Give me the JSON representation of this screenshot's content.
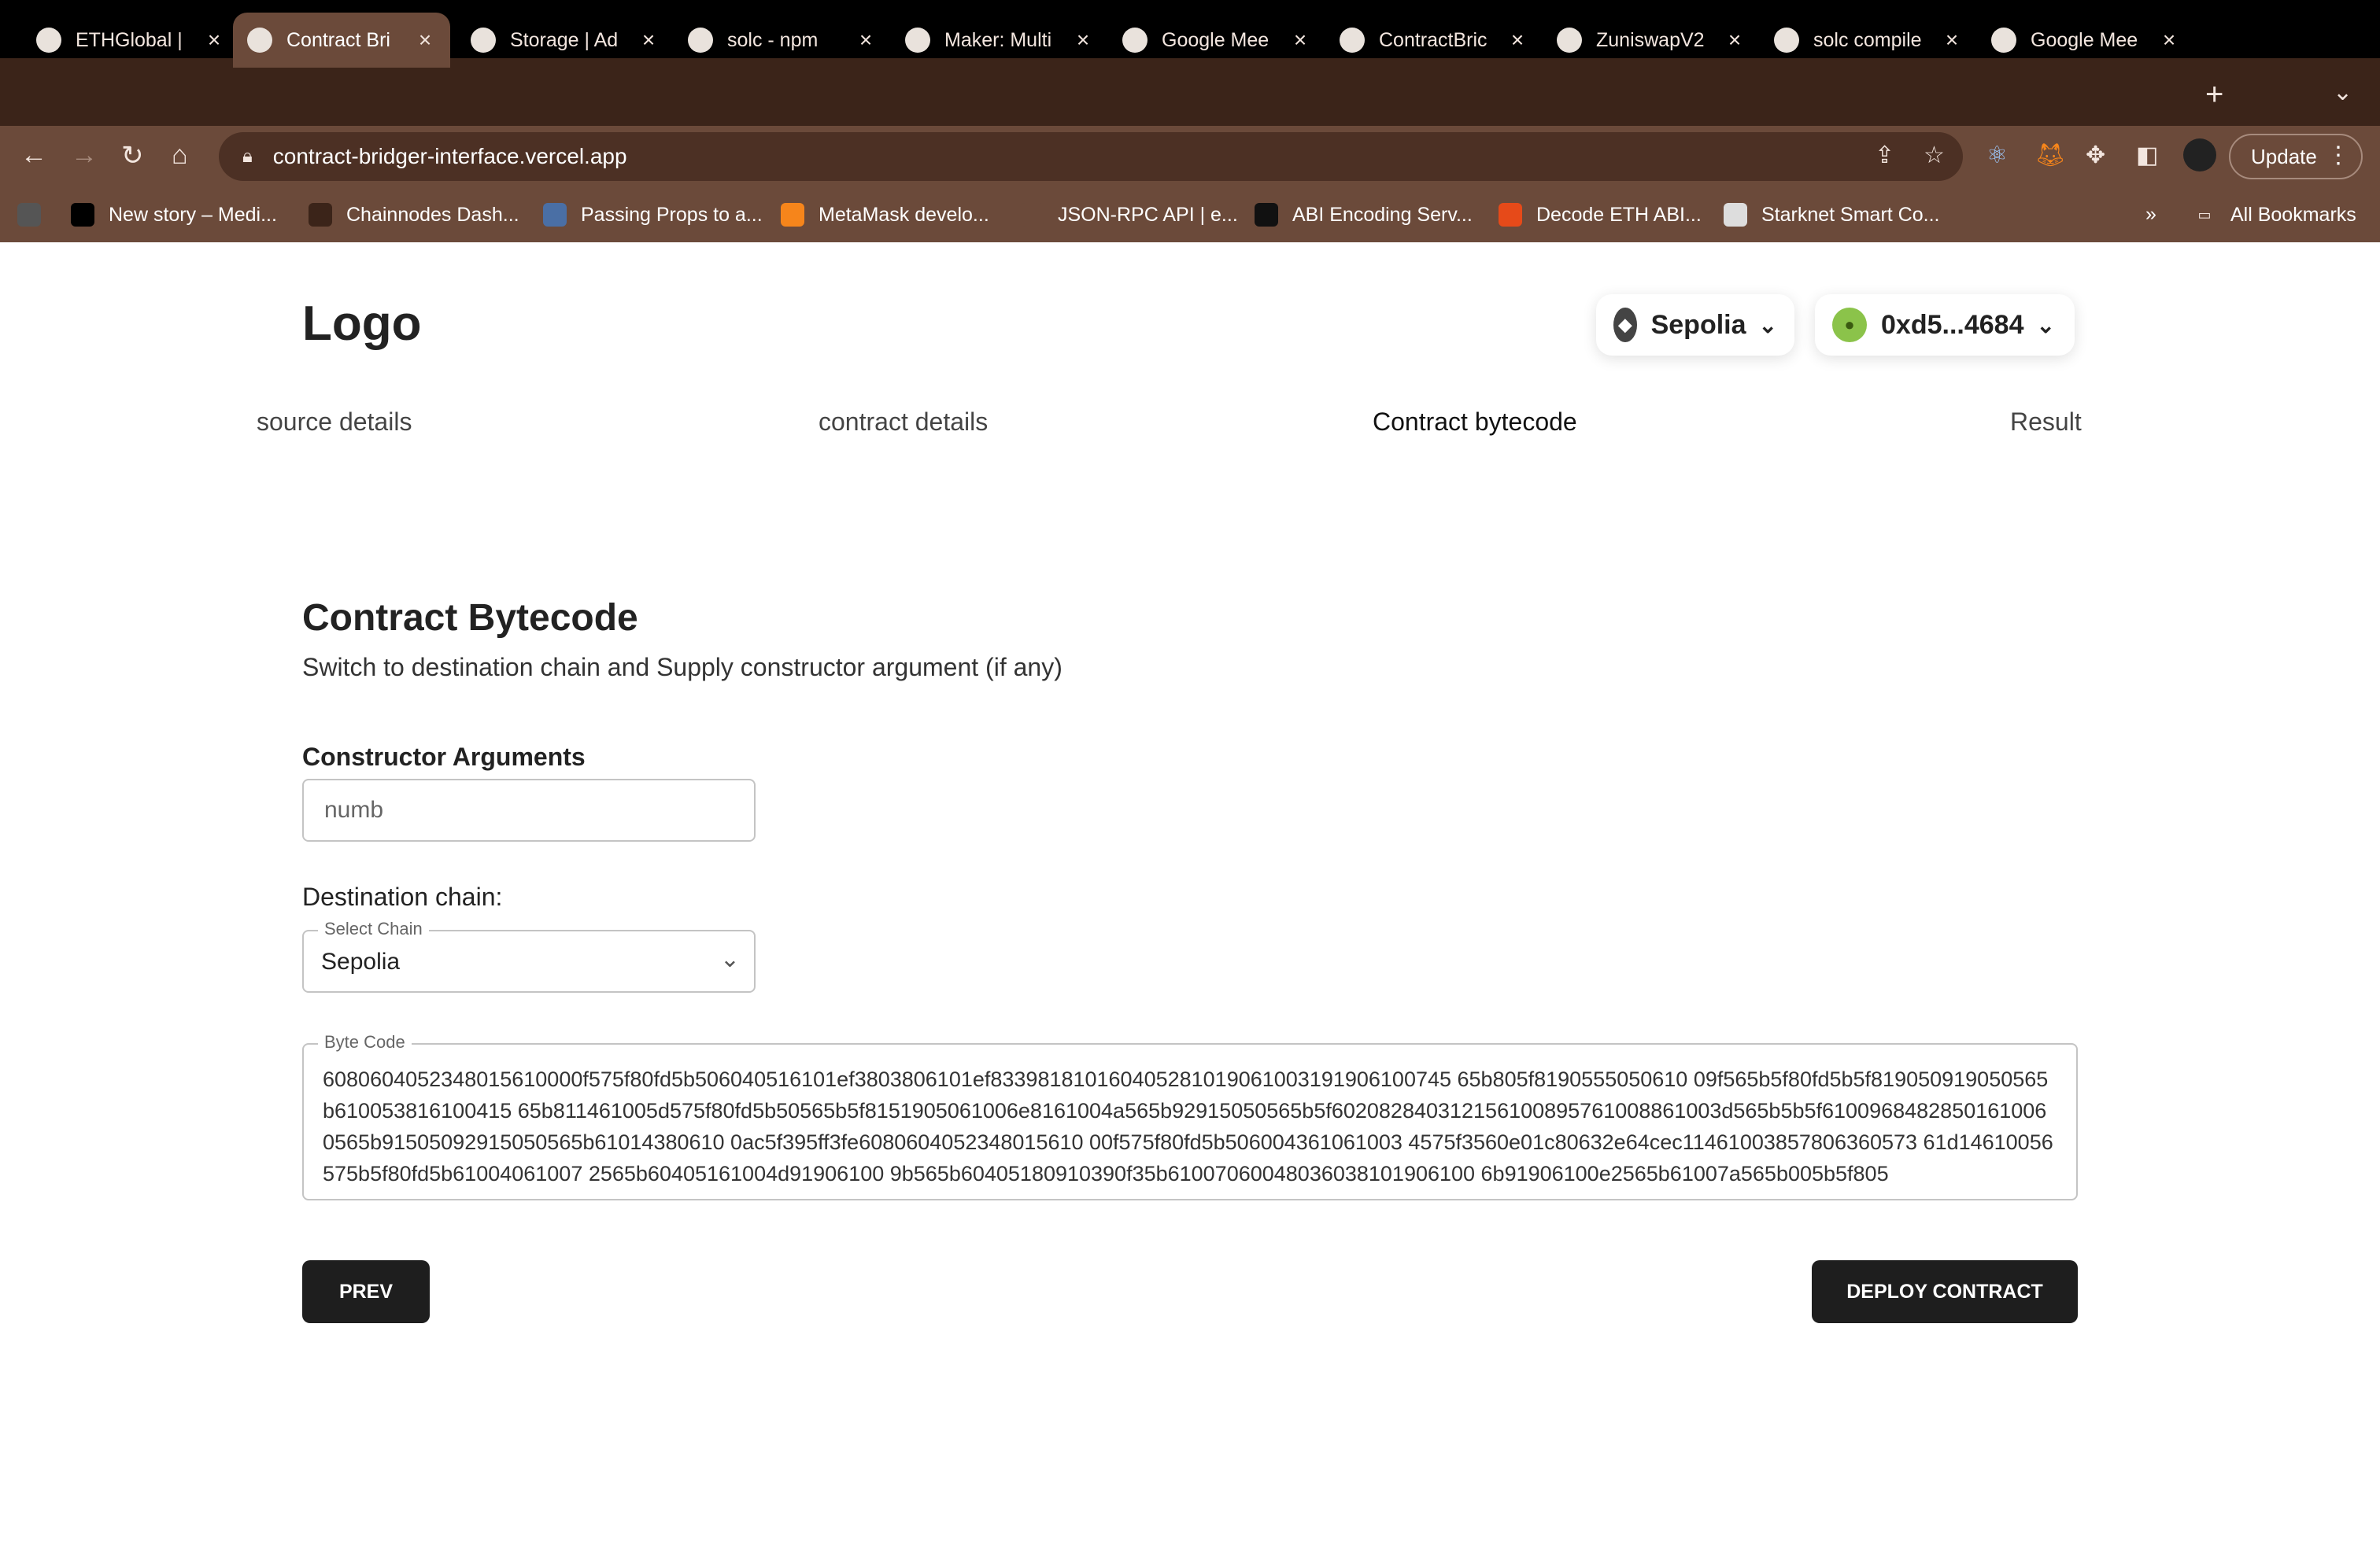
{
  "browser": {
    "tabs": [
      {
        "label": "ETHGlobal |",
        "icon": "ethglobal-icon"
      },
      {
        "label": "Contract Bri",
        "icon": "globe-icon",
        "active": true
      },
      {
        "label": "Storage | Ad",
        "icon": "maker-icon"
      },
      {
        "label": "solc - npm",
        "icon": "npm-icon"
      },
      {
        "label": "Maker: Multi",
        "icon": "maker-icon"
      },
      {
        "label": "Google Mee",
        "icon": "google-meet-icon"
      },
      {
        "label": "ContractBric",
        "icon": "github-icon"
      },
      {
        "label": "ZuniswapV2",
        "icon": "maker-icon"
      },
      {
        "label": "solc compile",
        "icon": "google-icon"
      },
      {
        "label": "Google Mee",
        "icon": "google-meet-icon"
      }
    ],
    "url": "contract-bridger-interface.vercel.app",
    "update_label": "Update",
    "bookmarks": [
      {
        "label": "",
        "icon": "globe-icon"
      },
      {
        "label": "New story – Medi...",
        "icon": "medium-icon"
      },
      {
        "label": "Chainnodes Dash...",
        "icon": "chainnodes-icon"
      },
      {
        "label": "Passing Props to a...",
        "icon": "react-icon"
      },
      {
        "label": "MetaMask develo...",
        "icon": "metamask-icon"
      },
      {
        "label": "JSON-RPC API | e...",
        "icon": "ethereum-icon"
      },
      {
        "label": "ABI Encoding Serv...",
        "icon": "hash-icon"
      },
      {
        "label": "Decode ETH ABI...",
        "icon": "decode-icon"
      },
      {
        "label": "Starknet Smart Co...",
        "icon": "starknet-icon"
      }
    ],
    "bookmarks_more": "»",
    "all_bookmarks": "All Bookmarks"
  },
  "header": {
    "logo": "Logo",
    "network": "Sepolia",
    "account": "0xd5...4684"
  },
  "steps": [
    "source details",
    "contract details",
    "Contract bytecode",
    "Result"
  ],
  "main": {
    "title": "Contract Bytecode",
    "subtitle": "Switch to destination chain and Supply constructor argument (if any)",
    "constructor_label": "Constructor Arguments",
    "constructor_placeholder": "numb",
    "destination_label": "Destination chain:",
    "select_legend": "Select Chain",
    "select_value": "Sepolia",
    "bytecode_legend": "Byte Code",
    "bytecode": "6080604052348015610000f575f80fd5b506040516101ef3803806101ef833981810160405281019061003191906100745 65b805f8190555050610 09f565b5f80fd5b5f819050919050565b610053816100415 65b811461005d575f80fd5b50565b5f8151905061006e8161004a565b92915050565b5f602082840312156100895761008861003d565b5b5f6100968482850161006 0565b91505092915050565b61014380610 0ac5f395ff3fe6080604052348015610 00f575f80fd5b506004361061003 4575f3560e01c80632e64cec11461003857806360573 61d14610056575b5f80fd5b61004061007 2565b60405161004d91906100 9b565b60405180910390f35b61007060048036038101906100 6b91906100e2565b61007a565b005b5f805",
    "prev_label": "PREV",
    "deploy_label": "DEPLOY CONTRACT"
  },
  "colors": {
    "tabstrip": "#3b2419",
    "toolbar": "#6b4a3a",
    "button": "#1e1e1e"
  }
}
